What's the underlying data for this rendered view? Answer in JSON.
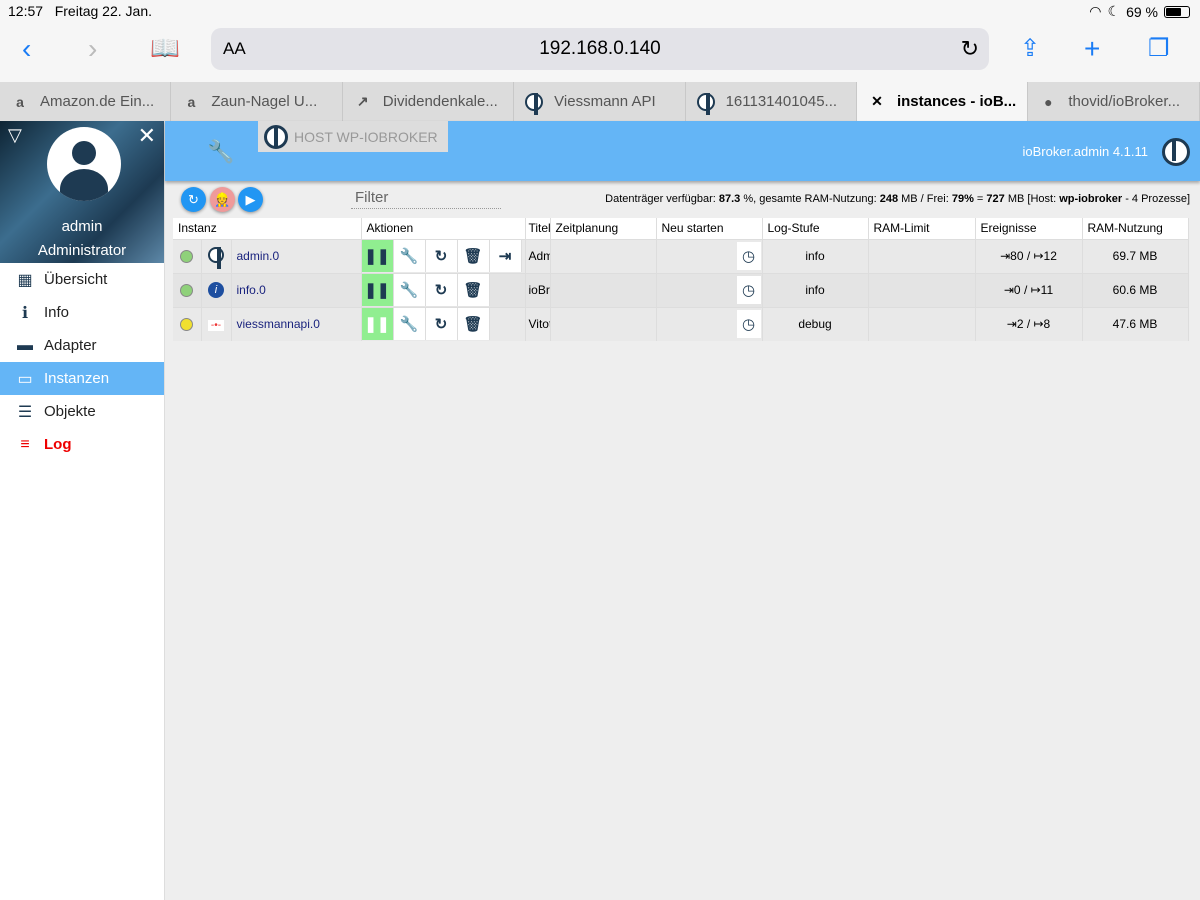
{
  "status_bar": {
    "time": "12:57",
    "date": "Freitag 22. Jan.",
    "battery": "69 %",
    "battery_level": 0.69
  },
  "browser": {
    "url": "192.168.0.140",
    "text_size": "AA"
  },
  "tabs": [
    {
      "label": "Amazon.de Ein...",
      "icon": "amazon-icon",
      "fav": "a"
    },
    {
      "label": "Zaun-Nagel U...",
      "icon": "amazon-icon",
      "fav": "a"
    },
    {
      "label": "Dividendenkale...",
      "icon": "chart-icon",
      "fav": "↗"
    },
    {
      "label": "Viessmann API",
      "icon": "iobroker-icon",
      "fav": ""
    },
    {
      "label": "161131401045...",
      "icon": "iobroker-icon",
      "fav": ""
    },
    {
      "label": "instances - ioB...",
      "icon": "close-icon",
      "fav": "✕",
      "active": true
    },
    {
      "label": "thovid/ioBroker...",
      "icon": "github-icon",
      "fav": "●"
    }
  ],
  "sidebar": {
    "user": "admin",
    "role": "Administrator",
    "items": [
      {
        "label": "Übersicht",
        "icon": "grid-icon",
        "glyph": "▦"
      },
      {
        "label": "Info",
        "icon": "info-icon",
        "glyph": "ℹ"
      },
      {
        "label": "Adapter",
        "icon": "store-icon",
        "glyph": "▬"
      },
      {
        "label": "Instanzen",
        "icon": "instances-icon",
        "glyph": "▭",
        "active": true
      },
      {
        "label": "Objekte",
        "icon": "list-icon",
        "glyph": "☰"
      },
      {
        "label": "Log",
        "icon": "log-icon",
        "glyph": "≡",
        "log": true
      }
    ]
  },
  "header": {
    "host_button": "HOST WP-IOBROKER",
    "version": "ioBroker.admin 4.1.11"
  },
  "toolbar": {
    "filter_placeholder": "Filter",
    "disk_label": "Datenträger verfügbar: ",
    "disk": "87.3",
    "ram_label": " %, gesamte RAM-Nutzung: ",
    "ram": "248",
    "free_label": " MB / Frei: ",
    "free_pct": "79%",
    "eq": " = ",
    "free_mb": "727",
    "host_label": " MB [Host: ",
    "host": "wp-iobroker",
    "proc": " - 4 Prozesse]"
  },
  "table": {
    "headers": [
      "Instanz",
      "Aktionen",
      "Titel",
      "Zeitplanung",
      "Neu starten",
      "Log-Stufe",
      "RAM-Limit",
      "Ereignisse",
      "RAM-Nutzung"
    ],
    "rows": [
      {
        "status": "#8fd17a",
        "name": "admin.0",
        "title": "Admin",
        "log": "info",
        "events": "⇥80 / ↦12",
        "ram": "69.7 MB",
        "paused": false,
        "extra": true
      },
      {
        "status": "#8fd17a",
        "name": "info.0",
        "title": "ioBroker.info",
        "log": "info",
        "events": "⇥0 / ↦11",
        "ram": "60.6 MB",
        "paused": false,
        "extra": false
      },
      {
        "status": "#f0e030",
        "name": "viessmannapi.0",
        "title": "Vitotrol",
        "log": "debug",
        "events": "⇥2 / ↦8",
        "ram": "47.6 MB",
        "paused": true,
        "extra": false
      }
    ]
  }
}
